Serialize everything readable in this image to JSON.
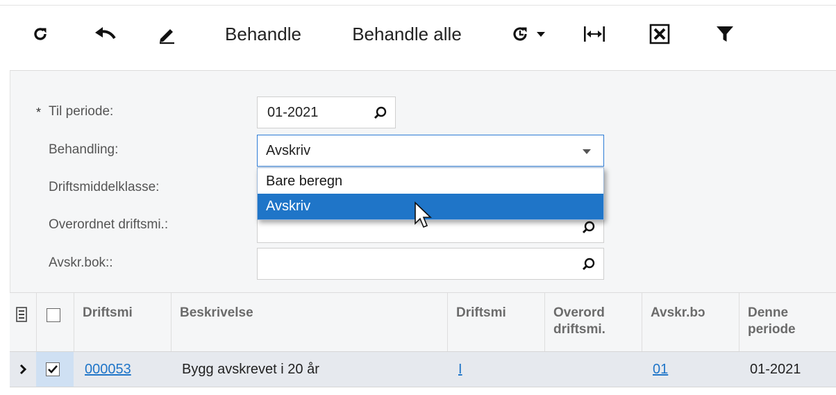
{
  "toolbar": {
    "process_label": "Behandle",
    "process_all_label": "Behandle alle"
  },
  "form": {
    "to_period": {
      "label": "Til periode:",
      "required_mark": "*",
      "value": "01-2021"
    },
    "processing": {
      "label": "Behandling:",
      "value": "Avskriv"
    },
    "asset_class": {
      "label": "Driftsmiddelklasse:"
    },
    "parent_asset": {
      "label": "Overordnet driftsmi.:"
    },
    "depr_book": {
      "label": "Avskr.bok::"
    }
  },
  "dropdown": {
    "options": [
      "Bare beregn",
      "Avskriv"
    ],
    "selected": "Avskriv"
  },
  "grid": {
    "columns": [
      "Driftsmi",
      "Beskrivelse",
      "Driftsmi",
      "Overord driftsmi.",
      "Avskr.bɔ",
      "Denne periode"
    ],
    "column_lines": {
      "c3a": "Overord",
      "c3b": "driftsmi.",
      "c5a": "Denne",
      "c5b": "periode"
    },
    "rows": [
      {
        "selected": true,
        "asset_id": "000053",
        "description": "Bygg avskrevet i 20 år",
        "asset_link": "I",
        "parent": "",
        "book": "01",
        "period": "01-2021"
      }
    ]
  }
}
